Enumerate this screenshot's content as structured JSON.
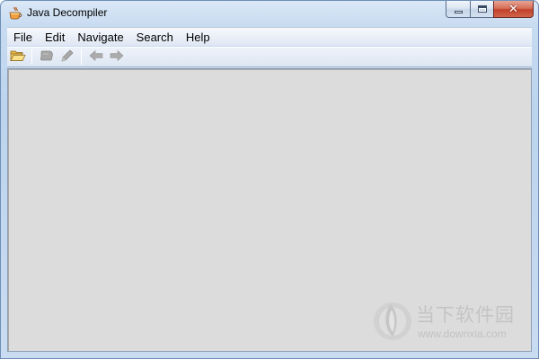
{
  "window": {
    "title": "Java Decompiler",
    "app_icon": "coffee-cup-icon",
    "caption_buttons": [
      {
        "name": "minimize",
        "icon": "minimize-icon"
      },
      {
        "name": "maximize",
        "icon": "maximize-icon"
      },
      {
        "name": "close",
        "icon": "close-icon",
        "glyph": "✕"
      }
    ]
  },
  "menubar": {
    "items": [
      {
        "label": "File"
      },
      {
        "label": "Edit"
      },
      {
        "label": "Navigate"
      },
      {
        "label": "Search"
      },
      {
        "label": "Help"
      }
    ]
  },
  "toolbar": {
    "buttons": [
      {
        "name": "open-file",
        "icon": "open-folder-icon",
        "enabled": true
      },
      {
        "name": "open-type",
        "icon": "class-icon",
        "enabled": false
      },
      {
        "name": "search",
        "icon": "pencil-icon",
        "enabled": false
      },
      {
        "name": "back",
        "icon": "arrow-left-icon",
        "enabled": false
      },
      {
        "name": "forward",
        "icon": "arrow-right-icon",
        "enabled": false
      }
    ]
  },
  "watermark": {
    "text_cn": "当下软件园",
    "url": "www.downxia.com"
  },
  "colors": {
    "content_bg": "#dcdcdc",
    "close_button": "#c7452e",
    "frame": "#c7dbf1"
  }
}
